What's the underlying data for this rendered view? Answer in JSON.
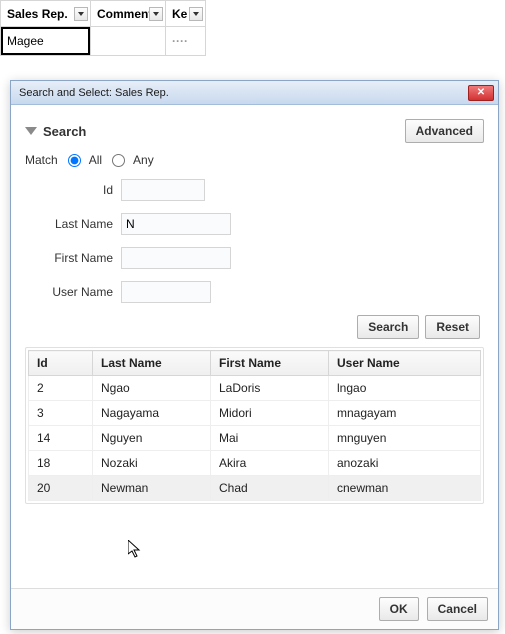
{
  "background": {
    "columns": {
      "sales_rep": "Sales Rep.",
      "comments": "Comments",
      "ke": "Ke"
    },
    "cell_value": "Magee"
  },
  "dialog": {
    "title": "Search and Select: Sales Rep.",
    "close_glyph": "✕",
    "search_label": "Search",
    "advanced_label": "Advanced",
    "match_label": "Match",
    "match_all": "All",
    "match_any": "Any",
    "fields": {
      "id_label": "Id",
      "id_value": "",
      "last_name_label": "Last Name",
      "last_name_value": "N",
      "first_name_label": "First Name",
      "first_name_value": "",
      "user_name_label": "User Name",
      "user_name_value": ""
    },
    "search_btn": "Search",
    "reset_btn": "Reset",
    "columns": {
      "id": "Id",
      "last": "Last Name",
      "first": "First Name",
      "user": "User Name"
    },
    "rows": [
      {
        "id": "2",
        "last": "Ngao",
        "first": "LaDoris",
        "user": "lngao"
      },
      {
        "id": "3",
        "last": "Nagayama",
        "first": "Midori",
        "user": "mnagayam"
      },
      {
        "id": "14",
        "last": "Nguyen",
        "first": "Mai",
        "user": "mnguyen"
      },
      {
        "id": "18",
        "last": "Nozaki",
        "first": "Akira",
        "user": "anozaki"
      },
      {
        "id": "20",
        "last": "Newman",
        "first": "Chad",
        "user": "cnewman"
      }
    ],
    "ok_label": "OK",
    "cancel_label": "Cancel"
  }
}
